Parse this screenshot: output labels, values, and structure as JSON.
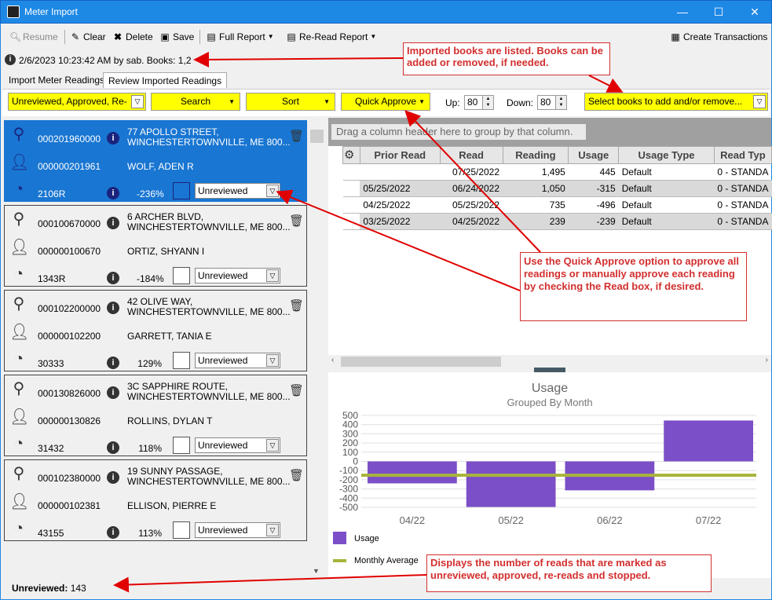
{
  "window": {
    "title": "Meter Import",
    "min": "—",
    "max": "☐",
    "close": "✕"
  },
  "toolbar": {
    "resume": "Resume",
    "clear": "Clear",
    "delete": "Delete",
    "save": "Save",
    "full_report": "Full Report",
    "reread_report": "Re-Read Report",
    "create_transactions": "Create Transactions"
  },
  "info_line": "2/6/2023 10:23:42 AM by sab.  Books: 1,2",
  "tabs": [
    "Import Meter Readings",
    "Review Imported Readings"
  ],
  "filter": {
    "status_filter": "Unreviewed, Approved, Re-",
    "search": "Search",
    "sort": "Sort",
    "quick_approve": "Quick Approve",
    "up_label": "Up:",
    "up_value": "80",
    "down_label": "Down:",
    "down_value": "80",
    "books_select": "Select books to add and/or remove..."
  },
  "readings": [
    {
      "account": "000201960000",
      "address1": "77 APOLLO STREET,",
      "address2": "WINCHESTERTOWNVILLE,  ME 800...",
      "customer": "000000201961",
      "name": "WOLF, ADEN R",
      "meter": "2106R",
      "percent": "-236%",
      "status": "Unreviewed"
    },
    {
      "account": "000100670000",
      "address1": "6 ARCHER BLVD,",
      "address2": "WINCHESTERTOWNVILLE,  ME 800...",
      "customer": "000000100670",
      "name": "ORTIZ, SHYANN I",
      "meter": "1343R",
      "percent": "-184%",
      "status": "Unreviewed"
    },
    {
      "account": "000102200000",
      "address1": "42 OLIVE WAY,",
      "address2": "WINCHESTERTOWNVILLE,  ME 800...",
      "customer": "000000102200",
      "name": "GARRETT, TANIA E",
      "meter": "30333",
      "percent": "129%",
      "status": "Unreviewed"
    },
    {
      "account": "000130826000",
      "address1": "3C SAPPHIRE ROUTE,",
      "address2": "WINCHESTERTOWNVILLE,  ME 800...",
      "customer": "000000130826",
      "name": "ROLLINS, DYLAN T",
      "meter": "31432",
      "percent": "118%",
      "status": "Unreviewed"
    },
    {
      "account": "000102380000",
      "address1": "19 SUNNY PASSAGE,",
      "address2": "WINCHESTERTOWNVILLE,  ME 800...",
      "customer": "000000102381",
      "name": "ELLISON, PIERRE E",
      "meter": "43155",
      "percent": "113%",
      "status": "Unreviewed"
    }
  ],
  "grid": {
    "group_prompt": "Drag a column header here to group by that column.",
    "columns": [
      "Prior Read",
      "Read",
      "Reading",
      "Usage",
      "Usage Type",
      "Read Typ"
    ],
    "rows": [
      [
        "",
        "07/25/2022",
        "1,495",
        "445",
        "Default",
        "0 - STANDA"
      ],
      [
        "05/25/2022",
        "06/24/2022",
        "1,050",
        "-315",
        "Default",
        "0 - STANDA"
      ],
      [
        "04/25/2022",
        "05/25/2022",
        "735",
        "-496",
        "Default",
        "0 - STANDA"
      ],
      [
        "03/25/2022",
        "04/25/2022",
        "239",
        "-239",
        "Default",
        "0 - STANDA"
      ]
    ]
  },
  "chart_data": {
    "type": "bar",
    "title": "Usage",
    "subtitle": "Grouped By Month",
    "categories": [
      "04/22",
      "05/22",
      "06/22",
      "07/22"
    ],
    "series": [
      {
        "name": "Usage",
        "values": [
          -239,
          -496,
          -315,
          445
        ],
        "color": "#7b4fc7"
      },
      {
        "name": "Monthly Average",
        "values": [
          -151,
          -151,
          -151,
          -151
        ],
        "color": "#a8b43a"
      }
    ],
    "yticks": [
      "500",
      "400",
      "300",
      "200",
      "100",
      "0",
      "-100",
      "-200",
      "-300",
      "-400",
      "-500"
    ],
    "ylim": [
      -500,
      500
    ],
    "grid": true,
    "legend": "bottom-left"
  },
  "annotations": {
    "books": "Imported books are listed.  Books can be added or removed, if needed.",
    "quick_approve": "Use the Quick Approve option to approve all readings or manually approve each reading by checking the Read box, if desired.",
    "status": "Displays the number of reads that are marked as unreviewed, approved, re-reads and stopped."
  },
  "statusbar": {
    "label": "Unreviewed:",
    "count": "143"
  }
}
